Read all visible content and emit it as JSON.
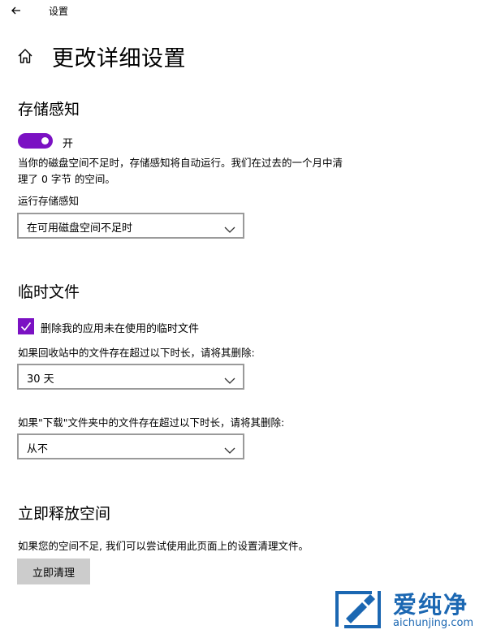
{
  "window": {
    "title": "设置"
  },
  "page": {
    "title": "更改详细设置"
  },
  "storage_sense": {
    "heading": "存储感知",
    "toggle_state": "开",
    "toggle_on": true,
    "description_line1": "当你的磁盘空间不足时，存储感知将自动运行。我们在过去的一个月中清",
    "description_line2": "理了 0 字节 的空间。",
    "run_label": "运行存储感知",
    "run_value": "在可用磁盘空间不足时"
  },
  "temp_files": {
    "heading": "临时文件",
    "checkbox_label": "删除我的应用未在使用的临时文件",
    "checkbox_checked": true,
    "recycle_label": "如果回收站中的文件存在超过以下时长，请将其删除:",
    "recycle_value": "30 天",
    "downloads_label": "如果\"下载\"文件夹中的文件存在超过以下时长，请将其删除:",
    "downloads_value": "从不"
  },
  "free_up": {
    "heading": "立即释放空间",
    "description": "如果您的空间不足, 我们可以尝试使用此页面上的设置清理文件。",
    "button_label": "立即清理"
  },
  "watermark": {
    "text": "爱纯净",
    "url": "aichunjing.com"
  },
  "colors": {
    "accent": "#7b11c3",
    "button_bg": "#cccccc",
    "border": "#9a9a9a",
    "watermark": "#1b67b2"
  }
}
